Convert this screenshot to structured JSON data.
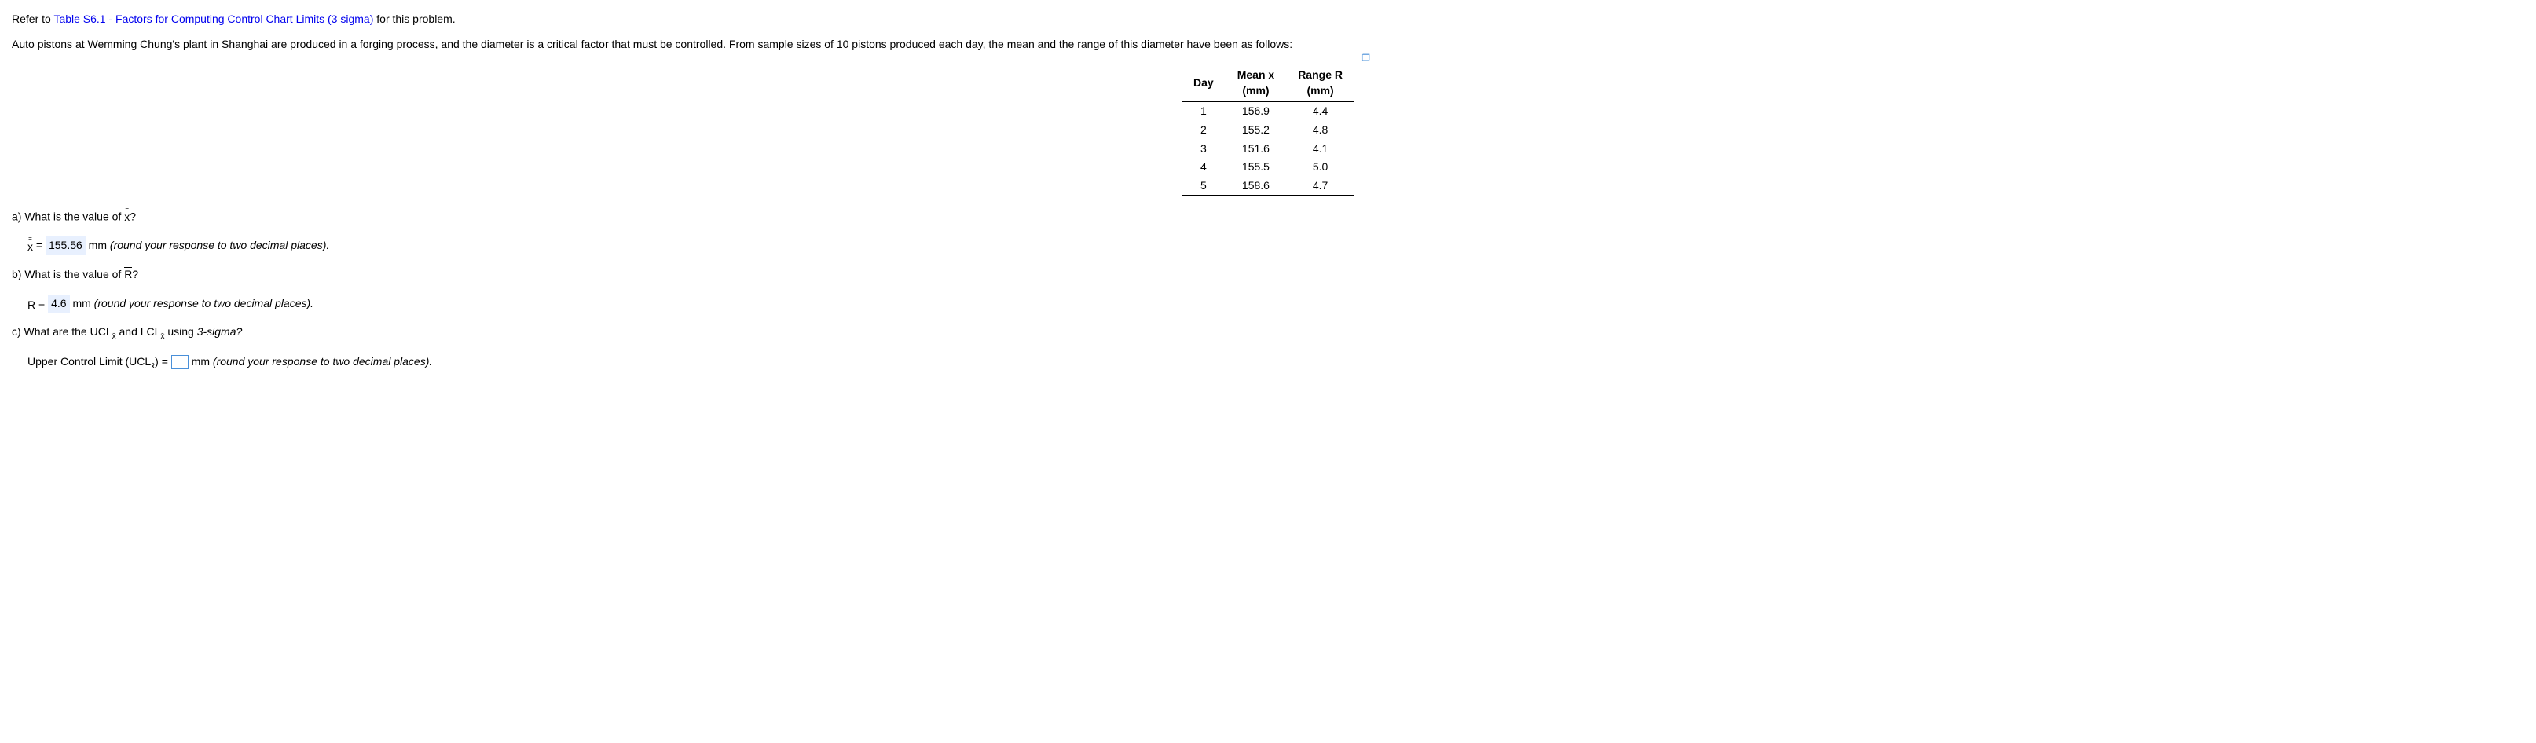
{
  "intro": {
    "refer_pre": "Refer to ",
    "link_text": "Table S6.1 - Factors for Computing Control Chart Limits (3 sigma)",
    "refer_post": " for this problem.",
    "context": "Auto pistons at Wemming Chung's plant in Shanghai are produced in a forging process, and the diameter is a critical factor that must be controlled. From sample sizes of 10 pistons produced each day, the mean and the range of this diameter have been as follows:"
  },
  "table": {
    "headers": {
      "day": "Day",
      "mean_top": "Mean",
      "mean_x": "x",
      "mean_unit": "(mm)",
      "range_top": "Range R",
      "range_unit": "(mm)"
    },
    "rows": [
      {
        "day": "1",
        "mean": "156.9",
        "range": "4.4"
      },
      {
        "day": "2",
        "mean": "155.2",
        "range": "4.8"
      },
      {
        "day": "3",
        "mean": "151.6",
        "range": "4.1"
      },
      {
        "day": "4",
        "mean": "155.5",
        "range": "5.0"
      },
      {
        "day": "5",
        "mean": "158.6",
        "range": "4.7"
      }
    ]
  },
  "qa": {
    "q_a_pre": "a) What is the value of ",
    "q_a_symbol": "x",
    "q_a_post": "?",
    "ans_a_pre": "x",
    "ans_a_eq": " = ",
    "ans_a_val": "155.56",
    "ans_a_unit": " mm ",
    "ans_a_hint": "(round your response to two decimal places).",
    "q_b_pre": "b) What is the value of ",
    "q_b_symbol": "R",
    "q_b_post": "?",
    "ans_b_pre": "R",
    "ans_b_eq": " = ",
    "ans_b_val": "4.6",
    "ans_b_unit": " mm ",
    "ans_b_hint": "(round your response to two decimal places).",
    "q_c_pre": "c) What are the ",
    "q_c_ucl": "UCL",
    "q_c_sub": "x̄",
    "q_c_and": " and ",
    "q_c_lcl": "LCL",
    "q_c_using": " using ",
    "q_c_sigma": "3-sigma?",
    "ans_c_label": "Upper Control Limit (UCL",
    "ans_c_close": ") = ",
    "ans_c_unit": " mm ",
    "ans_c_hint": "(round your response to two decimal places)."
  }
}
